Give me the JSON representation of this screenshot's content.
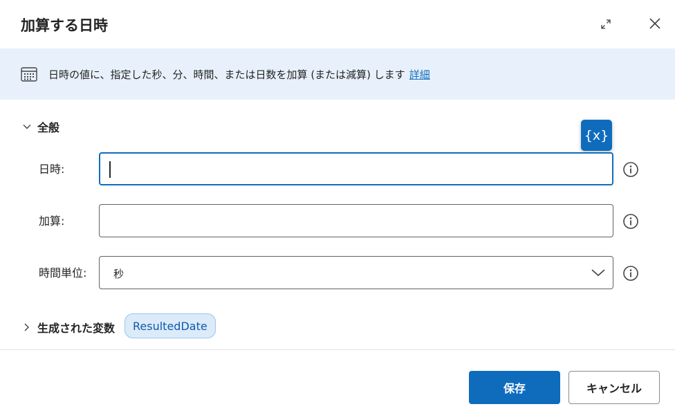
{
  "dialog": {
    "title": "加算する日時"
  },
  "banner": {
    "text": "日時の値に、指定した秒、分、時間、または日数を加算 (または減算) します",
    "link": "詳細"
  },
  "general": {
    "label": "全般",
    "variable_button": "{x}",
    "fields": {
      "datetime": {
        "label": "日時:",
        "value": ""
      },
      "add": {
        "label": "加算:",
        "value": ""
      },
      "unit": {
        "label": "時間単位:",
        "value": "秒"
      }
    }
  },
  "produced": {
    "label": "生成された変数",
    "variable": "ResultedDate"
  },
  "footer": {
    "save": "保存",
    "cancel": "キャンセル"
  },
  "colors": {
    "accent": "#0f6cbd",
    "banner_bg": "#e8f1fb",
    "chip_bg": "#dcebfa"
  }
}
